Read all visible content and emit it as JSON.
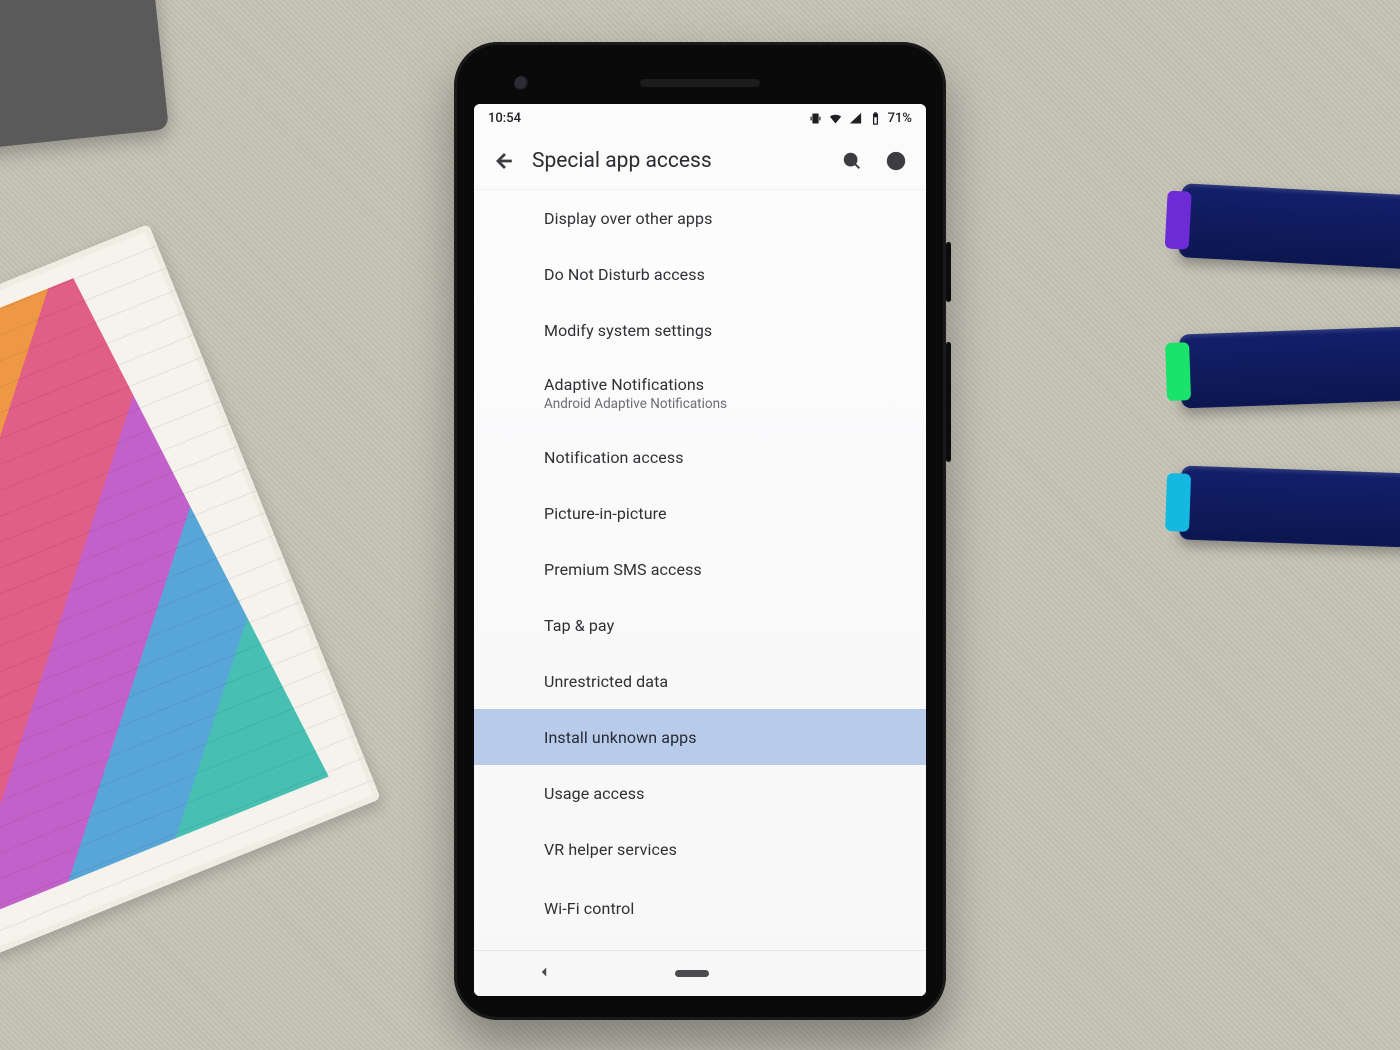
{
  "statusbar": {
    "time": "10:54",
    "battery_text": "71%",
    "icons": [
      "vibrate",
      "wifi",
      "signal",
      "battery"
    ]
  },
  "header": {
    "title": "Special app access"
  },
  "list": {
    "items": [
      {
        "label": "Display over other apps",
        "highlight": false
      },
      {
        "label": "Do Not Disturb access",
        "highlight": false
      },
      {
        "label": "Modify system settings",
        "highlight": false
      },
      {
        "label": "Adaptive Notifications",
        "sub": "Android Adaptive Notifications",
        "highlight": false
      },
      {
        "label": "Notification access",
        "highlight": false
      },
      {
        "label": "Picture-in-picture",
        "highlight": false
      },
      {
        "label": "Premium SMS access",
        "highlight": false
      },
      {
        "label": "Tap & pay",
        "highlight": false
      },
      {
        "label": "Unrestricted data",
        "highlight": false
      },
      {
        "label": "Install unknown apps",
        "highlight": true
      },
      {
        "label": "Usage access",
        "highlight": false
      },
      {
        "label": "VR helper services",
        "highlight": false
      },
      {
        "label": "Wi-Fi control",
        "highlight": false
      }
    ]
  }
}
